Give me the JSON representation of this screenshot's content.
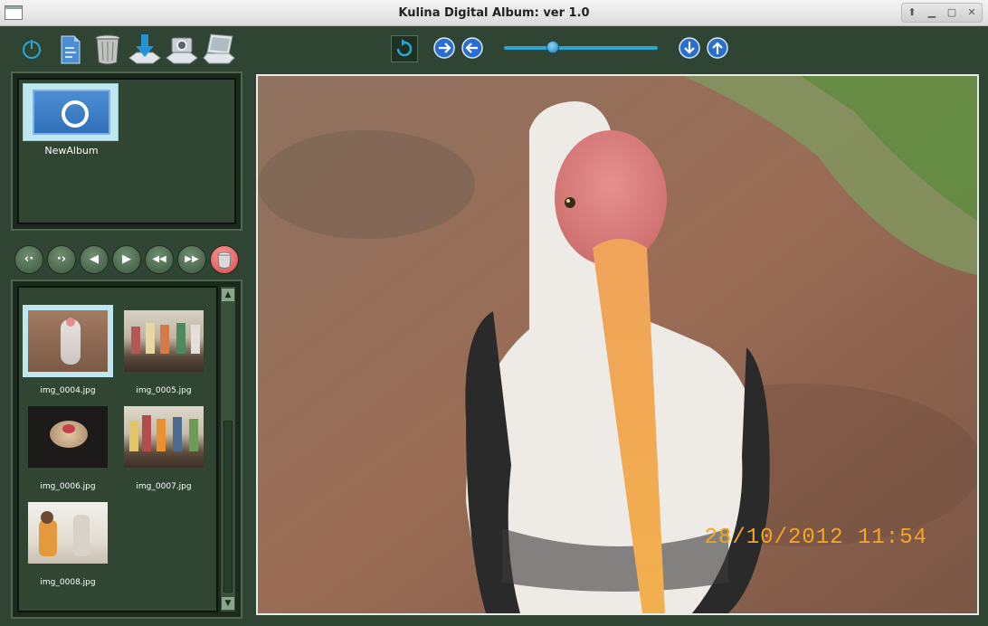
{
  "window": {
    "title": "Kulina Digital Album: ver 1.0",
    "controls": [
      "up-arrow",
      "minimize",
      "maximize",
      "close"
    ]
  },
  "toolbar": {
    "left_icons": [
      "power-icon",
      "document-icon",
      "trash-can-icon",
      "download-icon",
      "camera-icon",
      "laptop-icon"
    ],
    "center_icons": [
      "refresh-icon",
      "forward-arrow-icon",
      "back-arrow-icon"
    ],
    "right_icons": [
      "down-arrow-icon",
      "up-arrow-icon"
    ],
    "zoom_slider_value": 0.32,
    "colors": {
      "accent": "#2aa7d5",
      "panel": "#2f4432"
    }
  },
  "albums": [
    {
      "label": "NewAlbum",
      "selected": true
    }
  ],
  "nav_buttons": [
    "‹·",
    "·›",
    "◀",
    "▶",
    "◀◀",
    "▶▶"
  ],
  "photos": [
    {
      "caption": "img_0004.jpg",
      "selected": true
    },
    {
      "caption": "img_0005.jpg",
      "selected": false
    },
    {
      "caption": "img_0006.jpg",
      "selected": false
    },
    {
      "caption": "img_0007.jpg",
      "selected": false
    },
    {
      "caption": "img_0008.jpg",
      "selected": false
    }
  ],
  "viewer": {
    "timestamp": "28/10/2012  11:54"
  }
}
